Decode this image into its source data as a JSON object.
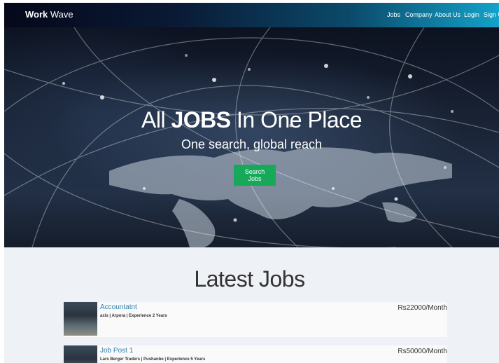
{
  "brand": {
    "strong": "Work",
    "rest": "Wave"
  },
  "nav": {
    "items": [
      "Jobs",
      "Company",
      "About Us",
      "Login",
      "Sign Up"
    ]
  },
  "hero": {
    "title_pre": "All",
    "title_bold": "JOBS",
    "title_post": "In One Place",
    "subtitle": "One search, global reach",
    "button": "Search Jobs"
  },
  "latest": {
    "title": "Latest Jobs",
    "jobs": [
      {
        "title": "Accountatnt",
        "meta": "axis | Arpora | Experience 2 Years",
        "salary": "Rs22000/Month"
      },
      {
        "title": "Job Post 1",
        "meta": "Lars Berger Traders | Pushanbe | Experience 5 Years",
        "salary": "Rs50000/Month"
      }
    ]
  },
  "colors": {
    "accent_green": "#17a85a",
    "link_blue": "#2f7fb0"
  }
}
